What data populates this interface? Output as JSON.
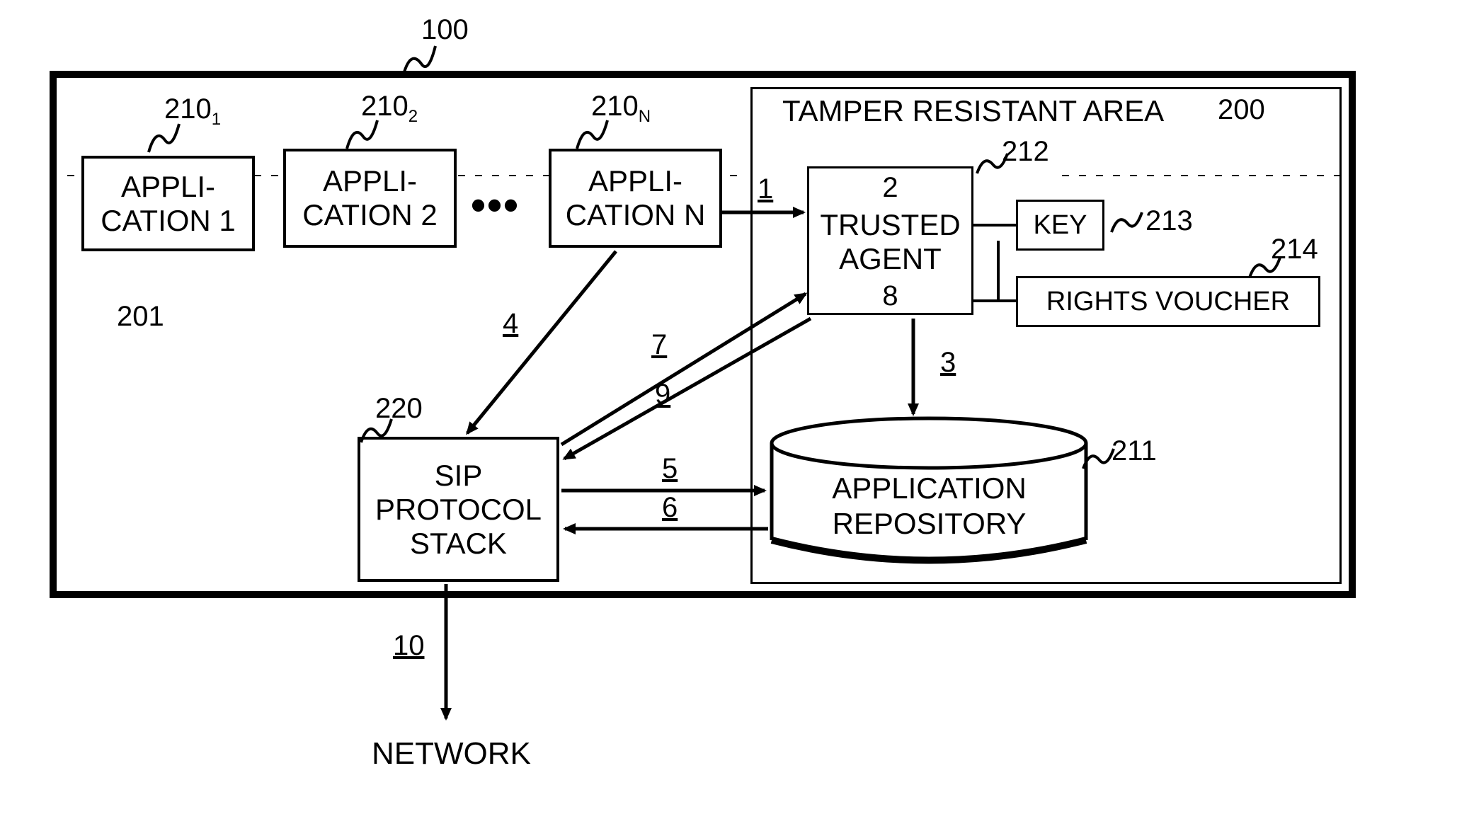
{
  "refs": {
    "outer": "100",
    "app_group": "201",
    "app1": "210",
    "app1_sub": "1",
    "app2": "210",
    "app2_sub": "2",
    "appN": "210",
    "appN_sub": "N",
    "sip": "220",
    "tra": "200",
    "trusted_agent": "212",
    "key": "213",
    "rights_voucher": "214",
    "repo": "211"
  },
  "boxes": {
    "app1": "APPLI-\nCATION 1",
    "app2": "APPLI-\nCATION 2",
    "appN": "APPLI-\nCATION N",
    "sip": "SIP\nPROTOCOL\nSTACK",
    "trusted_agent": "TRUSTED\nAGENT",
    "key": "KEY",
    "rights_voucher": "RIGHTS VOUCHER",
    "repo_line1": "APPLICATION",
    "repo_line2": "REPOSITORY",
    "tra_title": "TAMPER RESISTANT AREA"
  },
  "edges": {
    "e1": "1",
    "e2": "2",
    "e3": "3",
    "e4": "4",
    "e5": "5",
    "e6": "6",
    "e7": "7",
    "e8": "8",
    "e9": "9",
    "e10": "10"
  },
  "external": {
    "network": "NETWORK"
  },
  "dots": "•••"
}
